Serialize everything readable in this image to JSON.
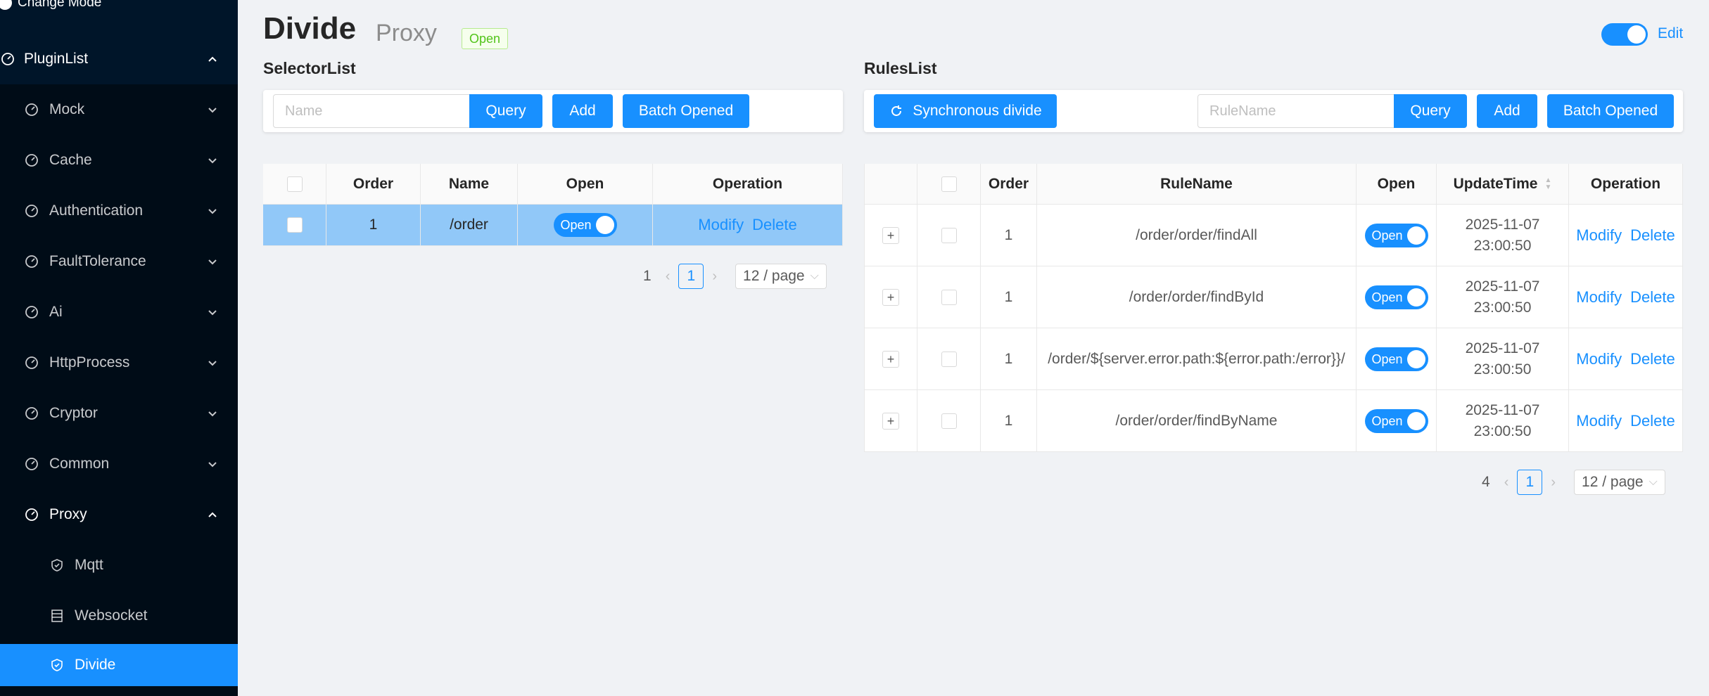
{
  "sidebar": {
    "change_mode": "Change Mode",
    "root": "PluginList",
    "items": [
      {
        "label": "Mock"
      },
      {
        "label": "Cache"
      },
      {
        "label": "Authentication"
      },
      {
        "label": "FaultTolerance"
      },
      {
        "label": "Ai"
      },
      {
        "label": "HttpProcess"
      },
      {
        "label": "Cryptor"
      },
      {
        "label": "Common"
      },
      {
        "label": "Proxy"
      }
    ],
    "sub_items": [
      {
        "label": "Mqtt"
      },
      {
        "label": "Websocket"
      },
      {
        "label": "Divide"
      }
    ]
  },
  "header": {
    "title": "Divide",
    "subtitle": "Proxy",
    "status": "Open",
    "edit": "Edit"
  },
  "selector": {
    "title": "SelectorList",
    "placeholder": "Name",
    "query": "Query",
    "add": "Add",
    "batch": "Batch Opened",
    "columns": [
      "Order",
      "Name",
      "Open",
      "Operation"
    ],
    "rows": [
      {
        "order": "1",
        "name": "/order",
        "open": "Open",
        "modify": "Modify",
        "delete": "Delete"
      }
    ],
    "total": "1",
    "page": "1",
    "page_size": "12 / page"
  },
  "rules": {
    "title": "RulesList",
    "sync": "Synchronous divide",
    "placeholder": "RuleName",
    "query": "Query",
    "add": "Add",
    "batch": "Batch Opened",
    "columns": [
      "Order",
      "RuleName",
      "Open",
      "UpdateTime",
      "Operation"
    ],
    "rows": [
      {
        "order": "1",
        "name": "/order/order/findAll",
        "open": "Open",
        "date": "2025-11-07",
        "time": "23:00:50",
        "modify": "Modify",
        "delete": "Delete"
      },
      {
        "order": "1",
        "name": "/order/order/findById",
        "open": "Open",
        "date": "2025-11-07",
        "time": "23:00:50",
        "modify": "Modify",
        "delete": "Delete"
      },
      {
        "order": "1",
        "name": "/order/${server.error.path:${error.path:/error}}/",
        "open": "Open",
        "date": "2025-11-07",
        "time": "23:00:50",
        "modify": "Modify",
        "delete": "Delete"
      },
      {
        "order": "1",
        "name": "/order/order/findByName",
        "open": "Open",
        "date": "2025-11-07",
        "time": "23:00:50",
        "modify": "Modify",
        "delete": "Delete"
      }
    ],
    "total": "4",
    "page": "1",
    "page_size": "12 / page"
  },
  "colors": {
    "sidebar_bg": "#001529",
    "primary": "#1890ff",
    "selected_row": "#91c8f8",
    "tag_green": "#52c41a"
  },
  "icons": {
    "menu": "dashboard-icon",
    "sub_mqtt": "shield-check-icon",
    "sub_websocket": "table-icon",
    "sub_divide": "shield-check-icon"
  }
}
